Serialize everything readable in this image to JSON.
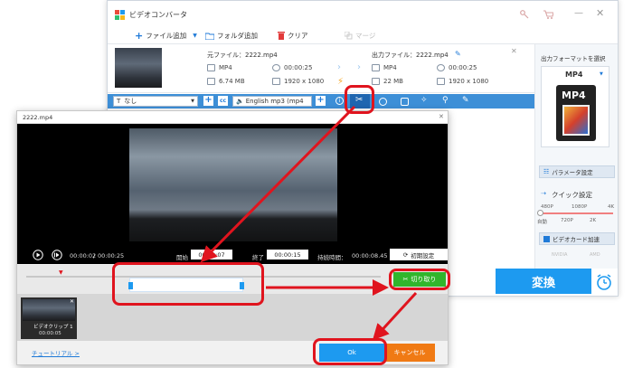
{
  "main": {
    "title": "ビデオコンバータ",
    "toolbar": {
      "add_file": "ファイル追加",
      "add_folder": "フォルダ追加",
      "clear": "クリア",
      "merge": "マージ"
    },
    "source": {
      "label": "元ファイル：2222.mp4",
      "format": "MP4",
      "duration": "00:00:25",
      "size": "6.74 MB",
      "resolution": "1920 x 1080"
    },
    "output": {
      "label": "出力ファイル：2222.mp4",
      "format": "MP4",
      "duration": "00:00:25",
      "size": "22 MB",
      "resolution": "1920 x 1080"
    },
    "edit_bar": {
      "subtitle_select": "なし",
      "audio_select": "English mp3 (mp4"
    },
    "right_panel": {
      "format_heading": "出力フォーマットを選択",
      "format_selected": "MP4",
      "param_settings": "パラメータ設定",
      "quick_settings": "クイック設定",
      "quality_top": [
        "480P",
        "1080P",
        "4K"
      ],
      "quality_bottom": [
        "自動",
        "720P",
        "2K"
      ],
      "gpu_accel": "ビデオカード加速",
      "gpu_vendors": [
        "NVIDIA",
        "AMD"
      ]
    },
    "convert_label": "変換"
  },
  "dialog": {
    "title": "2222.mp4",
    "current_time": "00:00:02",
    "total_time": "00:00:25",
    "start_label": "開始",
    "start_value": "00:00:07",
    "end_label": "終了",
    "end_value": "00:00:15",
    "duration_label": "持続時間：",
    "duration_value": "00:00:08.45",
    "reset_label": "初期設定",
    "cut_label": "切り取り",
    "clip_label": "ビデオクリップ 1",
    "clip_time": "00:00:05",
    "tutorial": "チュートリアル >",
    "ok_label": "Ok",
    "cancel_label": "キャンセル"
  },
  "colors": {
    "accent_blue": "#1d9af0",
    "edit_bar_blue": "#3d8fd7",
    "cut_green": "#31b52c",
    "cancel_orange": "#f07a14",
    "annotation_red": "#e0141e"
  }
}
